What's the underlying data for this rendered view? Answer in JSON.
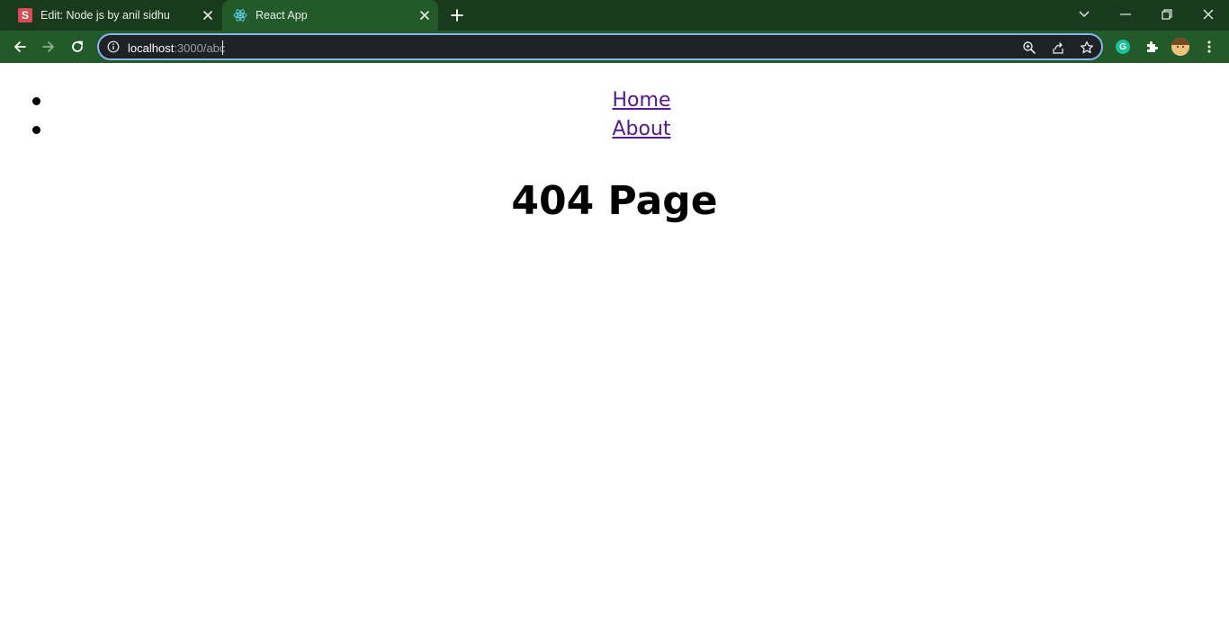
{
  "browser": {
    "tabs": [
      {
        "title": "Edit: Node js by anil sidhu",
        "favicon": "S",
        "active": false
      },
      {
        "title": "React App",
        "favicon": "react-icon",
        "active": true
      }
    ],
    "address": {
      "host": "localhost",
      "path": ":3000/abc"
    },
    "icons": {
      "back": "arrow-left-icon",
      "forward": "arrow-right-icon",
      "reload": "reload-icon",
      "info": "info-icon",
      "zoom": "zoom-icon",
      "share": "share-icon",
      "bookmark": "star-icon",
      "grammarly": "grammarly-icon",
      "extensions": "puzzle-icon",
      "profile": "avatar",
      "menu": "kebab-menu-icon"
    },
    "grammarly_letter": "G",
    "colors": {
      "titlebar": "#1a3a1d",
      "toolbar": "#235a2a",
      "omnibox_border": "#8ab4f8"
    }
  },
  "page": {
    "nav": [
      {
        "label": "Home"
      },
      {
        "label": "About"
      }
    ],
    "heading": "404 Page",
    "link_color": "#551a8b"
  }
}
